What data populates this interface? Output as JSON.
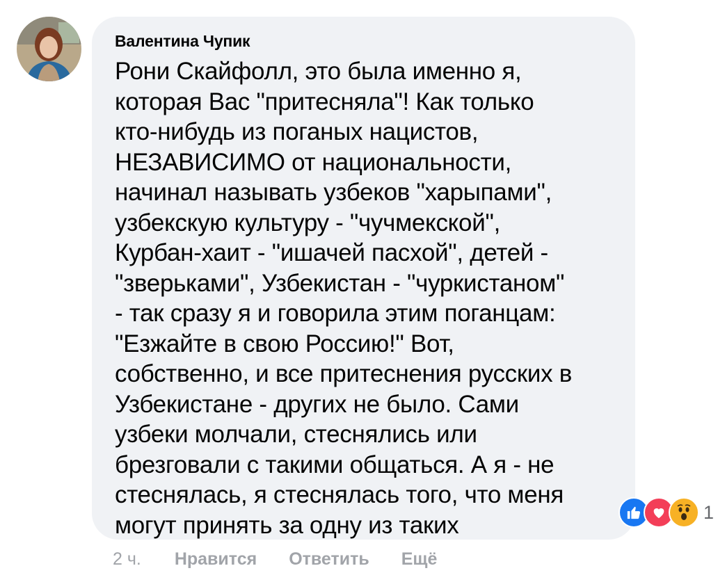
{
  "comment": {
    "author": "Валентина Чупик",
    "text": "Рони Скайфолл, это была именно я,\nкоторая Вас \"притесняла\"! Как только\nкто-нибудь из поганых нацистов,\nНЕЗАВИСИМО от национальности,\nначинал называть узбеков \"харыпами\",\nузбекскую культуру - \"чучмекской\",\nКурбан-хаит - \"ишачей пасхой\", детей -\n\"зверьками\", Узбекистан - \"чуркистаном\"\n- так сразу я и говорила этим поганцам:\n\"Езжайте в свою Россию!\" Вот,\nсобственно, и все притеснения русских в\nУзбекистане - других не было. Сами\nузбеки молчали, стеснялись или\nбрезговали с такими общаться. А я - не\nстеснялась, я стеснялась того, что меня\nмогут принять за одну из таких"
  },
  "reactions": {
    "icons": [
      "like-icon",
      "love-icon",
      "wow-icon"
    ],
    "count": "1",
    "colors": {
      "like": "#1877f2",
      "love": "#f33e58",
      "wow": "#f7b125"
    }
  },
  "actions": {
    "time": "2 ч.",
    "like_label": "Нравится",
    "reply_label": "Ответить",
    "more_label": "Ещё"
  },
  "colors": {
    "bubble_bg": "#f0f2f5",
    "text": "#050505",
    "muted": "#a1a4a9"
  }
}
